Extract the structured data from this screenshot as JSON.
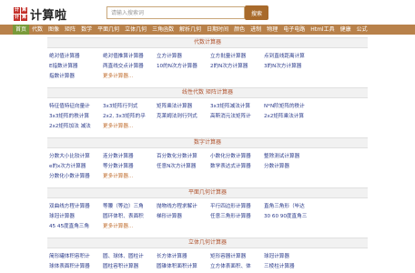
{
  "logo": {
    "mark": [
      "计",
      "算",
      "计",
      "算"
    ],
    "text": "计算啦"
  },
  "search": {
    "placeholder": "请输入搜索词",
    "button": "搜索"
  },
  "nav": [
    "首页",
    "代数",
    "图像",
    "矩阵",
    "数学",
    "平面几何",
    "立体几何",
    "三角函数",
    "解析几何",
    "日期时间",
    "颜色",
    "进制",
    "物理",
    "电子电路",
    "Html工具",
    "健康",
    "公式"
  ],
  "sections": [
    {
      "title": "代数计算器",
      "links": [
        "绝对值计算器",
        "绝对值推算计算器",
        "立方计算器",
        "立方批量计算器",
        "点到直线距离计算",
        "E指数计算器",
        "两直线交点计算器",
        "10的N次方计算器",
        "2的N次方计算器",
        "3的N次方计算器",
        "指数计算器",
        "更多计算器..."
      ]
    },
    {
      "title": "线性代数 矩阵计算器",
      "links": [
        "特征值特征向量计",
        "3x3矩阵行列式",
        "矩阵乘法计算器",
        "3x3矩阵减法计算",
        "N*N阶矩阵的秩计",
        "3x3矩阵的秩计算",
        "2x2, 3x3矩阵的乎",
        "克莱姆法则行列式",
        "高斯消元法矩阵计",
        "2x2矩阵乘法计算",
        "2x2矩阵加法 减法",
        "更多计算器..."
      ]
    },
    {
      "title": "数字计算器",
      "links": [
        "分数大小比较计算",
        "连分数计算器",
        "百分数化分数计算",
        "小数化分数计算器",
        "整除测试计算器",
        "e的x次方计算器",
        "等分数计算器",
        "任意N次方计算器",
        "数学表达式计算器",
        "分数计算器",
        "分数化小数计算器",
        "更多计算器..."
      ]
    },
    {
      "title": "平面几何计算器",
      "links": [
        "双曲线方程计算器",
        "等腰（等边）三角",
        "抛物线方程求解计",
        "平行四边形计算器",
        "直角三角形（毕达",
        "球冠计算器",
        "圆环体积、表面积",
        "梯形计算器",
        "任意三角形计算器",
        "30 60 90度直角三",
        "45 45度直角三角",
        "更多计算器..."
      ]
    },
    {
      "title": "立体几何计算器",
      "links": [
        "简形罐体积容积计",
        "圆、球体、圆柱计",
        "长方体计算器",
        "矩形容器计算器",
        "球冠计算器",
        "球体表面积计算器",
        "圆柱容积计算器",
        "圆锥体积面积计算",
        "立方体表面积、体",
        "三棱柱计算器"
      ]
    }
  ]
}
